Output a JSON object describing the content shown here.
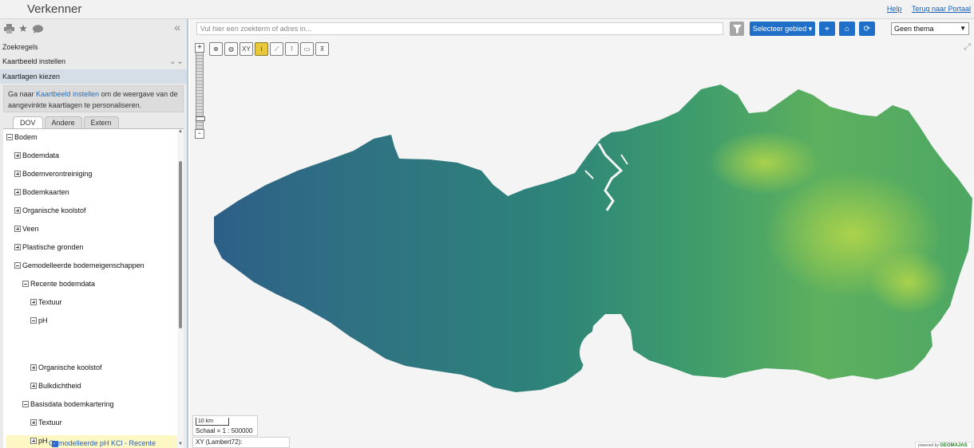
{
  "header": {
    "title": "Verkenner",
    "links": [
      "Help",
      "Terug naar Portaal"
    ]
  },
  "sidebar": {
    "tool_icons": [
      "print-icon",
      "star-icon",
      "comment-icon"
    ],
    "collapse_icon": "double-chevron-left-icon",
    "sections": [
      {
        "label": "Zoekregels"
      },
      {
        "label": "Kaartbeeld instellen"
      },
      {
        "label": "Kaartlagen kiezen"
      }
    ],
    "hint": {
      "prefix": "Ga naar ",
      "link": "Kaartbeeld instellen",
      "suffix": " om de weergave van de aangevinkte kaartlagen te personaliseren."
    },
    "tabs": [
      "DOV",
      "Andere",
      "Extern"
    ],
    "tree": [
      {
        "label": "Bodem",
        "toggle": "minus",
        "level": 0
      },
      {
        "label": "Bodemdata",
        "toggle": "plus",
        "level": 1
      },
      {
        "label": "Bodemverontreiniging",
        "toggle": "plus",
        "level": 1
      },
      {
        "label": "Bodemkaarten",
        "toggle": "plus",
        "level": 1
      },
      {
        "label": "Organische koolstof",
        "toggle": "plus",
        "level": 1
      },
      {
        "label": "Veen",
        "toggle": "plus",
        "level": 1
      },
      {
        "label": "Plastische gronden",
        "toggle": "plus",
        "level": 1
      },
      {
        "label": "Gemodelleerde bodemeigenschappen",
        "toggle": "minus",
        "level": 1
      },
      {
        "label": "Recente bodemdata",
        "toggle": "minus",
        "level": 2
      },
      {
        "label": "Textuur",
        "toggle": "plus",
        "level": 3
      },
      {
        "label": "pH",
        "toggle": "minus",
        "level": 3
      },
      {
        "label": "Organische koolstof",
        "toggle": "plus",
        "level": 3
      },
      {
        "label": "Bulkdichtheid",
        "toggle": "plus",
        "level": 3
      },
      {
        "label": "Basisdata bodemkartering",
        "toggle": "minus",
        "level": 2
      },
      {
        "label": "Textuur",
        "toggle": "plus",
        "level": 3
      },
      {
        "label": "pH",
        "toggle": "plus",
        "level": 3
      }
    ],
    "checked_layer": {
      "label": "Gemodelleerde pH KCl - Recente bodemdata",
      "checked": true
    }
  },
  "map": {
    "search_placeholder": "Vul hier een zoekterm of adres in...",
    "filter_icon": "filter-icon",
    "select_area_label": "Selecteer gebied",
    "action_icons": [
      "locate-icon",
      "home-icon",
      "refresh-icon"
    ],
    "theme_select": "Geen thema",
    "tools": [
      "zoom-icon",
      "globe-icon",
      "XY",
      "info-icon",
      "ruler-icon",
      "measure-icon",
      "print-area-icon",
      "legend-icon"
    ],
    "zoom_in": "+",
    "zoom_out": "-",
    "scale_bar": "10 km",
    "scale": "Schaal = 1 : 500000",
    "xy": "XY (Lambert72):",
    "powered_by": "powered by",
    "powered_brand": "GEOMAJAS",
    "colors": {
      "map_dark": "#2f6f84",
      "map_mid": "#2f8a7c",
      "map_light": "#6cbd54",
      "map_yellow": "#b7d94a",
      "accent": "#1f6fc9"
    }
  }
}
